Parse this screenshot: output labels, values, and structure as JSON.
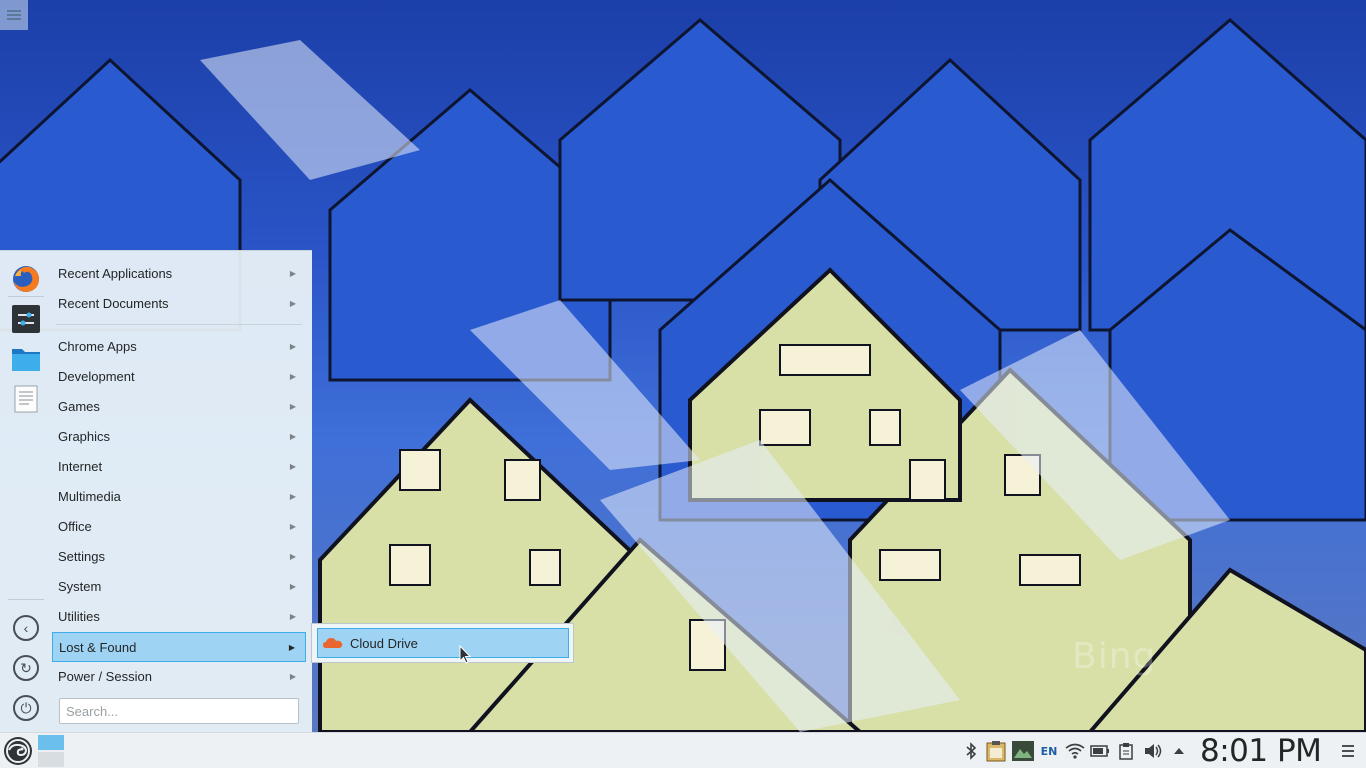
{
  "wallpaper": {
    "watermark": "Bing"
  },
  "favorites": [
    {
      "name": "firefox-icon"
    },
    {
      "name": "settings-icon"
    },
    {
      "name": "folder-icon"
    },
    {
      "name": "text-editor-icon"
    }
  ],
  "menu": {
    "top_items": [
      {
        "label": "Recent Applications"
      },
      {
        "label": "Recent Documents"
      }
    ],
    "items": [
      {
        "label": "Chrome Apps"
      },
      {
        "label": "Development"
      },
      {
        "label": "Games"
      },
      {
        "label": "Graphics"
      },
      {
        "label": "Internet"
      },
      {
        "label": "Multimedia"
      },
      {
        "label": "Office"
      },
      {
        "label": "Settings"
      },
      {
        "label": "System"
      },
      {
        "label": "Utilities"
      },
      {
        "label": "Lost & Found"
      },
      {
        "label": "Power / Session"
      }
    ],
    "active_item": "Lost & Found",
    "search_placeholder": "Search..."
  },
  "submenu": {
    "items": [
      {
        "label": "Cloud Drive",
        "icon": "cloud-icon"
      }
    ]
  },
  "panel": {
    "language": "EN",
    "clock": "8:01 PM"
  },
  "colors": {
    "accent": "#3daee9",
    "highlight": "#9fd3f3",
    "panel_bg": "#eef1f3"
  }
}
